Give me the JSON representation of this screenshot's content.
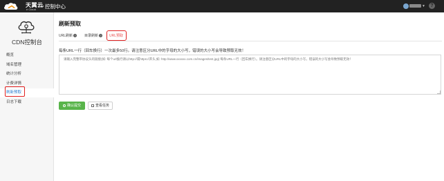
{
  "header": {
    "brand_cn": "天翼云",
    "brand_en": "e Cloud",
    "console_title": "控制中心",
    "help_label": "?"
  },
  "sidebar": {
    "title": "CDN控制台",
    "items": [
      {
        "label": "概览",
        "active": false
      },
      {
        "label": "域名管理",
        "active": false
      },
      {
        "label": "统计分析",
        "active": false
      },
      {
        "label": "计费详情",
        "active": false
      },
      {
        "label": "刷新预取",
        "active": true
      },
      {
        "label": "日志下载",
        "active": false
      }
    ]
  },
  "main": {
    "page_title": "刷新预取",
    "tabs": [
      {
        "label": "URL刷新",
        "help": "?"
      },
      {
        "label": "目录刷新",
        "help": "?"
      },
      {
        "label": "URL预取",
        "selected": true
      }
    ],
    "notice": "每条URL一行（回车换行）一次最多50行。请注意区分URL中的字母的大小写，错误的大小写会导致预取无效！",
    "textarea_placeholder": "请输入完整带协议头的链接(如: 每个url換行请以http://或https://开头,如: http://www.xxxxxx.com.cn/images/test.jpg) 每条URL一行（回车换行）。请注意区分URL中的字母的大小写，错误的大小写会导致预取无效！",
    "confirm_button": "确认提交",
    "task_button": "查看任务"
  },
  "colors": {
    "topbar": "#222222",
    "active_link": "#2d7fd0",
    "confirm_green": "#58b44a",
    "highlight_red": "#e02020"
  }
}
